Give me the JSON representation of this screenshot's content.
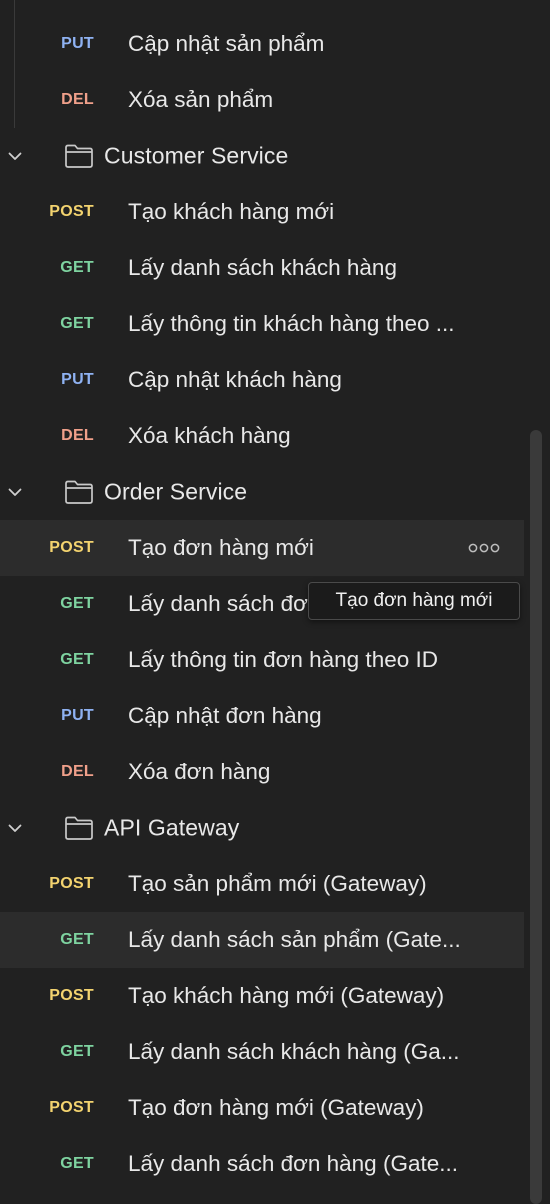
{
  "items": [
    {
      "kind": "request",
      "method": "PUT",
      "title": "Cập nhật sản phẩm"
    },
    {
      "kind": "request",
      "method": "DEL",
      "title": "Xóa sản phẩm"
    },
    {
      "kind": "folder",
      "title": "Customer Service"
    },
    {
      "kind": "request",
      "method": "POST",
      "title": "Tạo khách hàng mới"
    },
    {
      "kind": "request",
      "method": "GET",
      "title": "Lấy danh sách khách hàng"
    },
    {
      "kind": "request",
      "method": "GET",
      "title": "Lấy thông tin khách hàng theo ..."
    },
    {
      "kind": "request",
      "method": "PUT",
      "title": "Cập nhật khách hàng"
    },
    {
      "kind": "request",
      "method": "DEL",
      "title": "Xóa khách hàng"
    },
    {
      "kind": "folder",
      "title": "Order Service"
    },
    {
      "kind": "request",
      "method": "POST",
      "title": "Tạo đơn hàng mới",
      "hover": true
    },
    {
      "kind": "request",
      "method": "GET",
      "title": "Lấy danh sách đơn hàng"
    },
    {
      "kind": "request",
      "method": "GET",
      "title": "Lấy thông tin đơn hàng theo ID"
    },
    {
      "kind": "request",
      "method": "PUT",
      "title": "Cập nhật đơn hàng"
    },
    {
      "kind": "request",
      "method": "DEL",
      "title": "Xóa đơn hàng"
    },
    {
      "kind": "folder",
      "title": "API Gateway"
    },
    {
      "kind": "request",
      "method": "POST",
      "title": "Tạo sản phẩm mới (Gateway)"
    },
    {
      "kind": "request",
      "method": "GET",
      "title": "Lấy danh sách sản phẩm (Gate...",
      "hover": true
    },
    {
      "kind": "request",
      "method": "POST",
      "title": "Tạo khách hàng mới (Gateway)"
    },
    {
      "kind": "request",
      "method": "GET",
      "title": "Lấy danh sách khách hàng (Ga..."
    },
    {
      "kind": "request",
      "method": "POST",
      "title": "Tạo đơn hàng mới (Gateway)"
    },
    {
      "kind": "request",
      "method": "GET",
      "title": "Lấy danh sách đơn hàng (Gate..."
    }
  ],
  "tooltip": {
    "text": "Tạo đơn hàng mới"
  },
  "colors": {
    "PUT": "#8fb2f2",
    "DEL": "#f0a08a",
    "POST": "#f3d36f",
    "GET": "#7ed3a0",
    "background": "#212121",
    "hover": "#2c2c2c"
  },
  "icons": {
    "folder": "folder-icon",
    "chevron": "chevron-down-icon",
    "more": "more-options-icon"
  }
}
